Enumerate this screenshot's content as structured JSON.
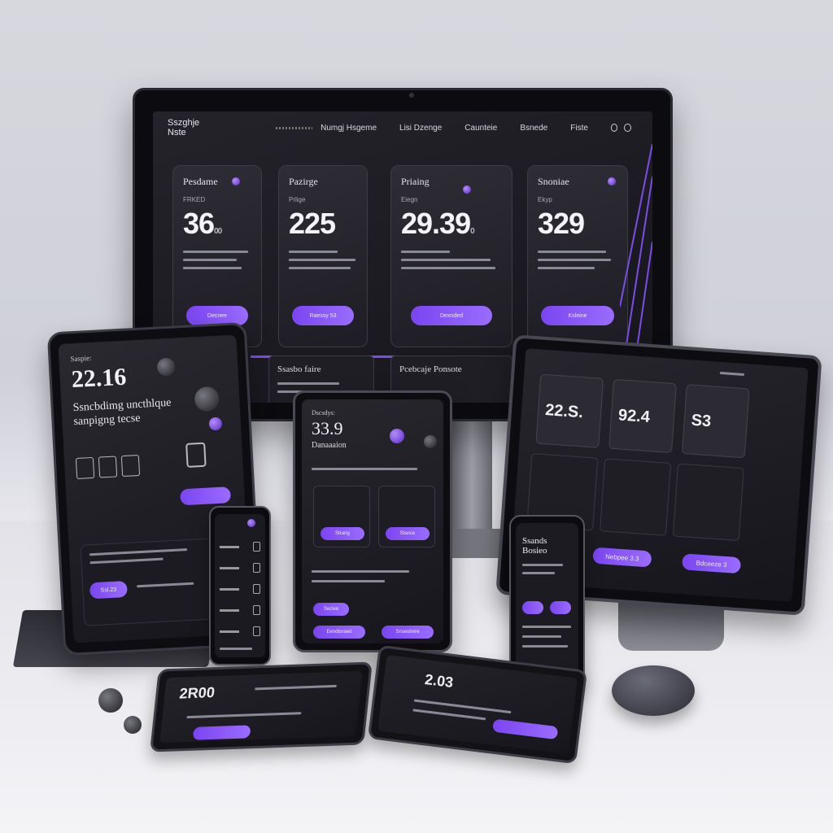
{
  "monitor": {
    "brand": "Sszghje Nste",
    "nav": [
      "Numgj Hsgeme",
      "Lisi Dzenge",
      "Caunteie",
      "Bsnede",
      "Fiste"
    ],
    "cards": [
      {
        "title": "Pesdame",
        "sub": "FRKED",
        "price": "36",
        "suffix": "00",
        "button": "Decnee"
      },
      {
        "title": "Pazirge",
        "sub": "Prlige",
        "price": "225",
        "suffix": "",
        "button": "Raessy 53"
      },
      {
        "title": "Priaing",
        "sub": "Eiegn",
        "price": "29.39",
        "suffix": "0",
        "button": "Dexnded"
      },
      {
        "title": "Snoniae",
        "sub": "Ekyp",
        "price": "329",
        "suffix": "",
        "button": "Ksleine"
      }
    ],
    "lower_panels": [
      "Ssasbo faire",
      "Pcebcaje Ponsote"
    ]
  },
  "tablet_left": {
    "label": "Saspie:",
    "big": "22.16",
    "heading_1": "Ssncbdimg uncthlque",
    "heading_2": "sanpigng tecse",
    "button": "Ssl.23"
  },
  "tablet_center": {
    "label": "Dscsdys:",
    "big": "33.9",
    "heading": "Danaaaion",
    "buttons": [
      "Strang",
      "Stance",
      "Seclee",
      "Eendtoraed",
      "Snsestrere"
    ]
  },
  "monitor_right": {
    "values": [
      "22.S.",
      "92.4",
      "S3"
    ],
    "buttons": [
      "Nebpee 3.3",
      "Bdceeze 3"
    ]
  },
  "phone_right": {
    "title_1": "Ssands",
    "title_2": "Bosieo"
  },
  "flat_left": {
    "value": "2R00"
  },
  "flat_right": {
    "value": "2.03"
  },
  "colors": {
    "accent": "#8b5cf6",
    "screen": "#1c1b22",
    "bezel": "#0c0c11"
  }
}
